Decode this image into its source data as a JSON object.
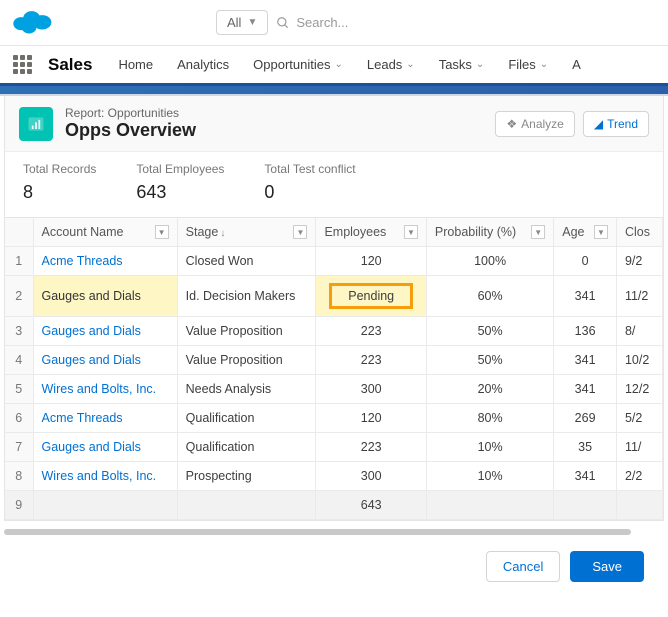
{
  "topbar": {
    "scope_label": "All",
    "search_placeholder": "Search..."
  },
  "nav": {
    "app_name": "Sales",
    "items": [
      "Home",
      "Analytics",
      "Opportunities",
      "Leads",
      "Tasks",
      "Files",
      "A"
    ]
  },
  "report": {
    "type_label": "Report: Opportunities",
    "title": "Opps Overview",
    "analyze_btn": "Analyze",
    "trend_btn": "Trend"
  },
  "totals": [
    {
      "label": "Total Records",
      "value": "8"
    },
    {
      "label": "Total Employees",
      "value": "643"
    },
    {
      "label": "Total Test conflict",
      "value": "0"
    }
  ],
  "columns": {
    "c0": "",
    "c1": "Account Name",
    "c2": "Stage",
    "c3": "Employees",
    "c4": "Probability (%)",
    "c5": "Age",
    "c6": "Clos"
  },
  "rows": [
    {
      "n": "1",
      "account": "Acme Threads",
      "stage": "Closed Won",
      "emp": "120",
      "prob": "100%",
      "age": "0",
      "close": "9/2"
    },
    {
      "n": "2",
      "account": "Gauges and Dials",
      "stage": "Id. Decision Makers",
      "emp": "Pending",
      "prob": "60%",
      "age": "341",
      "close": "11/2"
    },
    {
      "n": "3",
      "account": "Gauges and Dials",
      "stage": "Value Proposition",
      "emp": "223",
      "prob": "50%",
      "age": "136",
      "close": "8/"
    },
    {
      "n": "4",
      "account": "Gauges and Dials",
      "stage": "Value Proposition",
      "emp": "223",
      "prob": "50%",
      "age": "341",
      "close": "10/2"
    },
    {
      "n": "5",
      "account": "Wires and Bolts, Inc.",
      "stage": "Needs Analysis",
      "emp": "300",
      "prob": "20%",
      "age": "341",
      "close": "12/2"
    },
    {
      "n": "6",
      "account": "Acme Threads",
      "stage": "Qualification",
      "emp": "120",
      "prob": "80%",
      "age": "269",
      "close": "5/2"
    },
    {
      "n": "7",
      "account": "Gauges and Dials",
      "stage": "Qualification",
      "emp": "223",
      "prob": "10%",
      "age": "35",
      "close": "11/"
    },
    {
      "n": "8",
      "account": "Wires and Bolts, Inc.",
      "stage": "Prospecting",
      "emp": "300",
      "prob": "10%",
      "age": "341",
      "close": "2/2"
    }
  ],
  "summary": {
    "n": "9",
    "emp": "643"
  },
  "footer": {
    "cancel": "Cancel",
    "save": "Save"
  }
}
